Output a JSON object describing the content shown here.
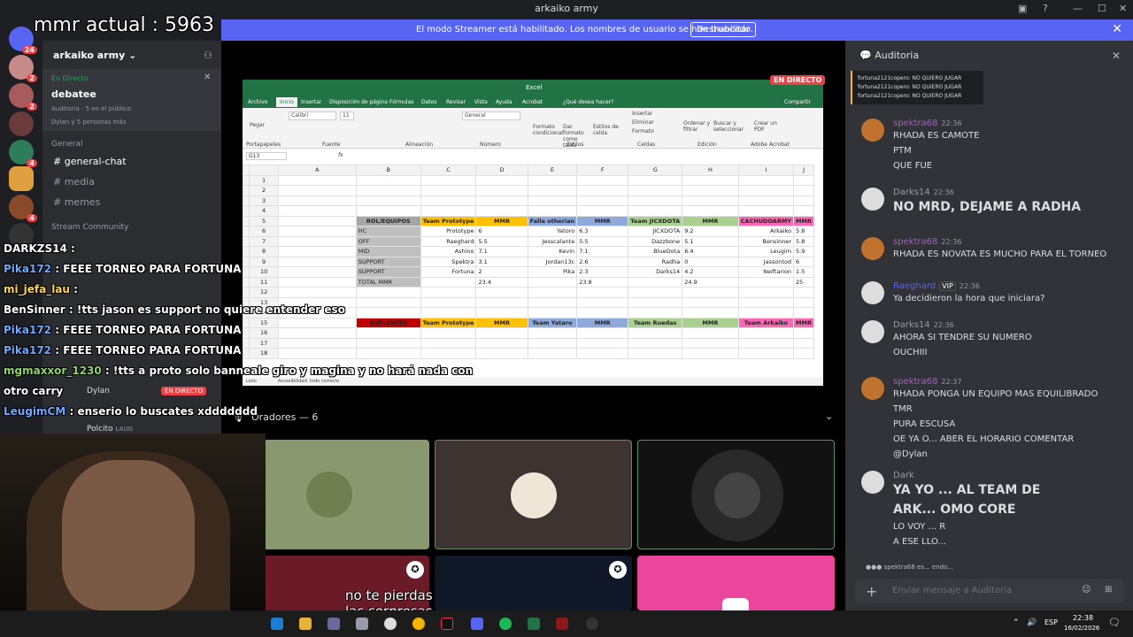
{
  "window": {
    "title": "arkaiko army"
  },
  "streamer_banner": {
    "text": "El modo Streamer está habilitado. Los nombres de usuario se han truncado.",
    "button": "Deshabilitar"
  },
  "overlay": {
    "mmr": "mmr actual : 5963"
  },
  "server": {
    "name": "arkaiko army",
    "live_label": "En Directo",
    "event_title": "debatee",
    "stage_name": "Auditoria",
    "public_count": "5 en el público",
    "participants": "Dylan y 5 personas más",
    "category_general": "General",
    "category_stream": "Stream Community",
    "channels": [
      "general-chat",
      "media",
      "memes"
    ],
    "stage_user": "Dylan",
    "stage_user_live": "EN DIRECTO",
    "stage_user2": "Polcito",
    "stage_user2_tag": "LAUG"
  },
  "server_badges": [
    "24",
    "2",
    "2",
    "4",
    "4"
  ],
  "stage": {
    "live_badge": "EN DIRECTO",
    "speakers_label": "Oradores — 6"
  },
  "excel": {
    "app_title": "Excel",
    "menu": [
      "Archivo",
      "Inicio",
      "Insertar",
      "Disposición de página",
      "Fórmulas",
      "Datos",
      "Revisar",
      "Vista",
      "Ayuda",
      "Acrobat",
      "¿Qué desea hacer?",
      "Compartir"
    ],
    "ribbon_groups": [
      "Portapapeles",
      "Fuente",
      "Alineación",
      "Número",
      "Estilos",
      "Celdas",
      "Edición",
      "Adobe Acrobat"
    ],
    "ribbon_buttons": [
      "Pegar",
      "Formato condicional",
      "Dar formato como tabla",
      "Estilos de celda",
      "Insertar",
      "Eliminar",
      "Formato",
      "Ordenar y filtrar",
      "Buscar y seleccionar",
      "Crear un PDF"
    ],
    "font_name": "Calibri",
    "font_size": "11",
    "number_format": "General",
    "cell_ref": "G13",
    "columns": [
      "A",
      "B",
      "C",
      "D",
      "E",
      "F",
      "G",
      "H",
      "I",
      "J"
    ],
    "header_row": [
      "ROL/EQUIPOS",
      "Team Prototype",
      "MMR",
      "Falla otherian",
      "MMR",
      "Team JICXDOTA",
      "MMR",
      "CACHUDOARMY",
      "MMR"
    ],
    "rows": [
      [
        "HC",
        "Prototype",
        "6",
        "Yatoro",
        "6.3",
        "JICXDOTA",
        "9.2",
        "Arkaiko",
        "5.8"
      ],
      [
        "OFF",
        "Raeghard",
        "5.5",
        "Jesscalante",
        "5.5",
        "Dazzbone",
        "5.1",
        "Bensinner",
        "5.8"
      ],
      [
        "MID",
        "Ashino",
        "7.1",
        "Kevin",
        "7.1",
        "BlueDota",
        "6.4",
        "Leugim",
        "5.9"
      ],
      [
        "SUPPORT",
        "Spektra",
        "3.1",
        "Jordan13c",
        "2.6",
        "Radha",
        "0",
        "Jassontod",
        "6"
      ],
      [
        "SUPPORT",
        "Fortuna",
        "2",
        "Pika",
        "2.3",
        "Darks14",
        "4.2",
        "Neiftarion",
        "1.5"
      ]
    ],
    "total_row": [
      "TOTAL MMR",
      "",
      "23.4",
      "",
      "23.8",
      "",
      "24.9",
      "",
      "25"
    ],
    "second_header": [
      "SUPLENTES",
      "Team Prototype",
      "MMR",
      "Team Yataro",
      "MMR",
      "Team Ruedas",
      "MMR",
      "Team Arkaiko",
      "MMR"
    ],
    "status_left": "Listo",
    "status_access": "Accesibilidad: todo correcto"
  },
  "overlay_chat": [
    {
      "user": "DARKZS14",
      "text": " : ",
      "color": "#ffffff"
    },
    {
      "user": "Pika172",
      "text": " : FEEE TORNEO PARA FORTUNA",
      "color": "#6fa8ff"
    },
    {
      "user": "mi_jefa_lau",
      "text": " : ",
      "color": "#ffd34d"
    },
    {
      "user": "BenSinner",
      "text": " : !tts jason es support no quiere entender eso",
      "color": "#ffffff"
    },
    {
      "user": "Pika172",
      "text": " : FEEE TORNEO PARA FORTUNA",
      "color": "#6fa8ff"
    },
    {
      "user": "Pika172",
      "text": " : FEEE TORNEO PARA FORTUNA",
      "color": "#6fa8ff"
    },
    {
      "user": "mgmaxxor_1230",
      "text": " : !tts a proto solo banneale giro y magina y no hará nada con",
      "color": "#8fd46b"
    },
    {
      "user": "",
      "text": "otro carry",
      "color": "#ffffff"
    },
    {
      "user": "LeugimCM",
      "text": " : enserio lo buscates xddddddd",
      "color": "#6fa8ff"
    }
  ],
  "chat": {
    "header": "Auditoria",
    "mini_lines": [
      "fortuna2121copero: NO QUIERO JUGAR",
      "fortuna2121copero: NO QUIERO JUGAR",
      "fortuna2121copero: NO QUIERO JUGAR"
    ],
    "messages": [
      {
        "user": "spektra68",
        "time": "22:36",
        "lines": [
          "RHADA ES CAMOTE",
          "PTM",
          "QUE FUE"
        ]
      },
      {
        "user": "Darks14",
        "time": "22:36",
        "lines": [
          "NO MRD, DEJAME A RADHA"
        ]
      },
      {
        "user": "spektra68",
        "time": "22:36",
        "lines": [
          "RHADA ES NOVATA ES MUCHO PARA EL TORNEO"
        ]
      },
      {
        "user": "Raeghard",
        "role": "VIP",
        "time": "22:36",
        "lines": [
          "Ya decidieron la hora que iniciara?"
        ]
      },
      {
        "user": "Darks14",
        "time": "22:36",
        "lines": [
          "AHORA SI TENDRE SU NUMERO",
          "OUCHIII"
        ]
      },
      {
        "user": "spektra68",
        "time": "22:37",
        "lines": [
          "RHADA PONGA UN EQUIPO MAS EQUILIBRADO",
          "TMR",
          "PURA ESCUSA",
          "OE YA O... ABER EL HORARIO COMENTAR",
          "@Dylan"
        ]
      },
      {
        "user": "Dark",
        "time": "",
        "lines": [
          "YA YO ... AL TEAM DE",
          "ARK... OMO CORE",
          "LO VOY ... R",
          "A ESE LLO..."
        ]
      }
    ],
    "typing": "spektra68 es... endo...",
    "input_placeholder": "Enviar mensaje a Auditoria"
  },
  "caption": {
    "line1": "no te pierdas",
    "line2": "las sorpresas"
  },
  "taskbar": {
    "lang": "ESP",
    "time": "22:38",
    "date": "16/02/2026"
  },
  "colors": {
    "blurple": "#5865f2",
    "excel_green": "#217346",
    "live_red": "#ed4245"
  }
}
